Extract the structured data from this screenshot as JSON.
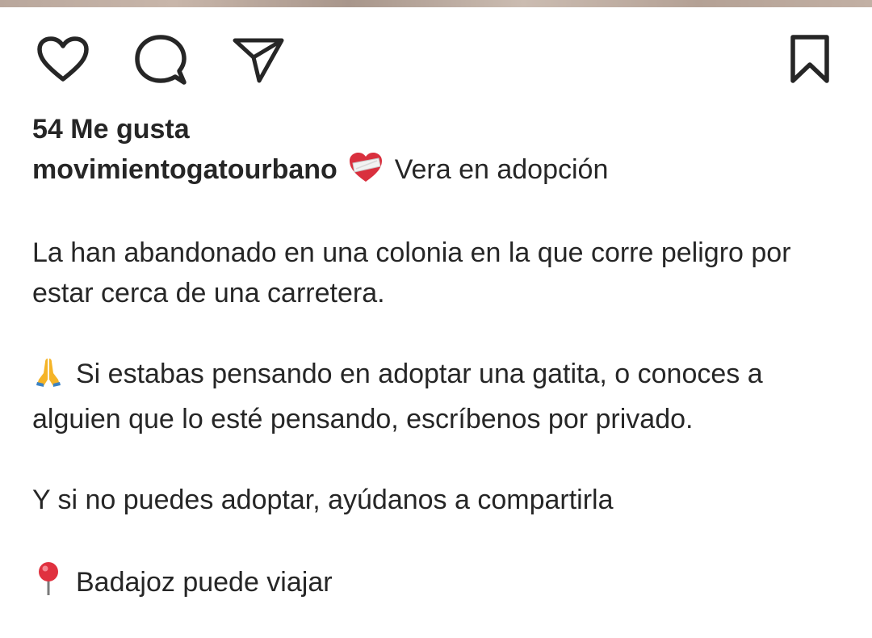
{
  "post": {
    "likes_text": "54 Me gusta",
    "username": "movimientogatourbano",
    "caption_first_line": "Vera en adopción",
    "paragraph_1": "La han abandonado en una colonia en la que corre peligro por estar cerca de una carretera.",
    "paragraph_2": "Si estabas pensando en adoptar una gatita, o conoces a alguien que lo esté pensando, escríbenos por privado.",
    "paragraph_3": "Y si no puedes adoptar, ayúdanos a compartirla",
    "paragraph_4": "Badajoz puede viajar"
  },
  "icons": {
    "like": "heart-outline-icon",
    "comment": "speech-bubble-icon",
    "share": "paper-plane-icon",
    "save": "bookmark-icon",
    "caption_emoji": "bandaged-heart-emoji",
    "praying_emoji": "folded-hands-emoji",
    "location_emoji": "round-pushpin-emoji"
  },
  "colors": {
    "text": "#262626",
    "background": "#ffffff"
  }
}
